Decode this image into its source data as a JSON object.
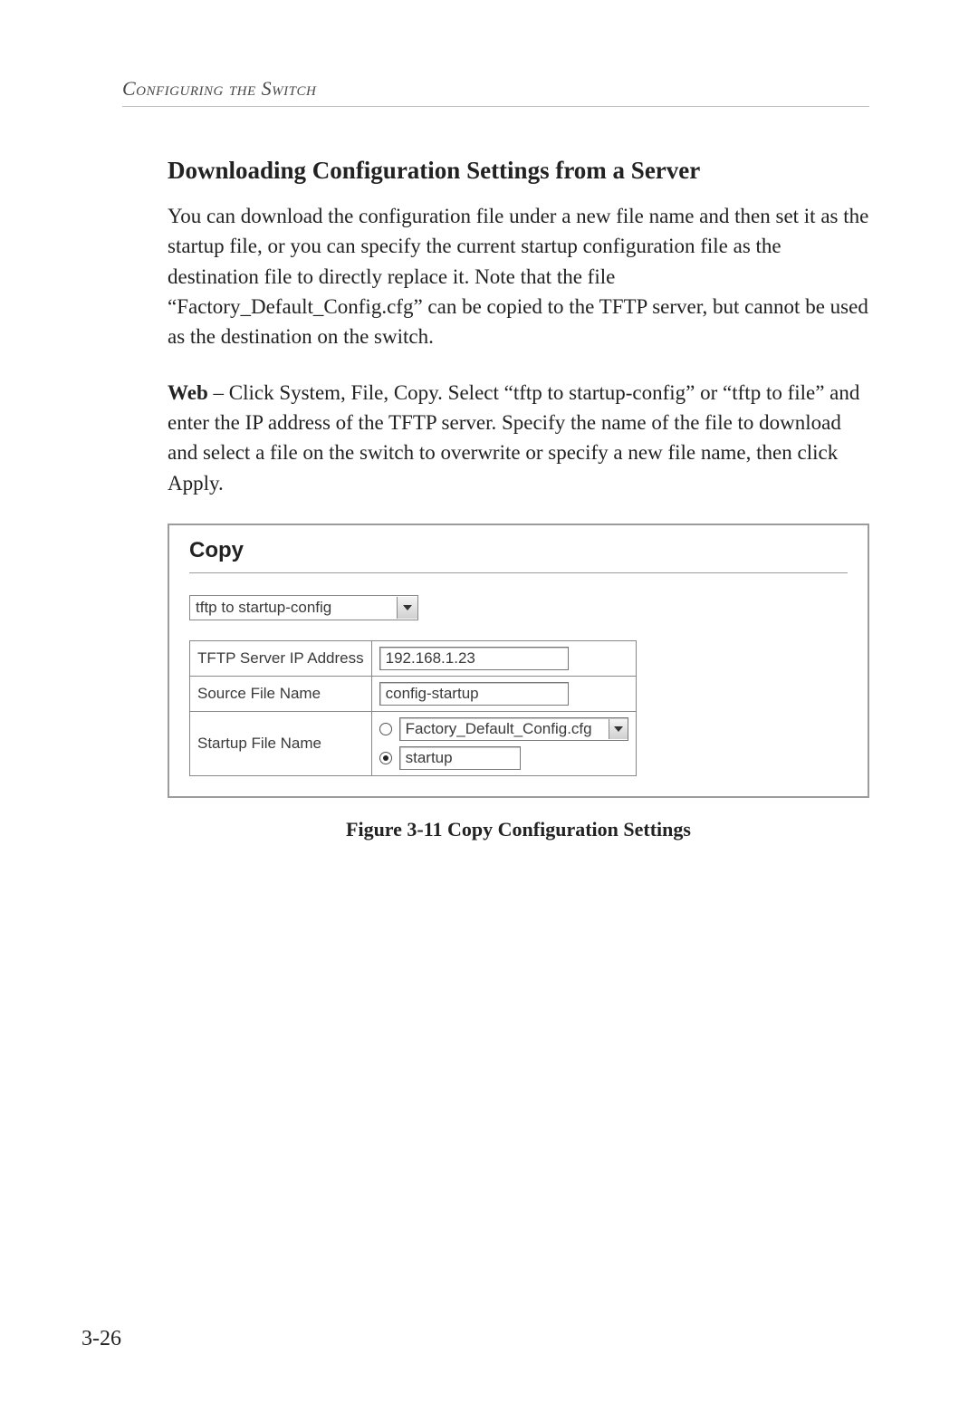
{
  "running_head": "Configuring the Switch",
  "section_title": "Downloading Configuration Settings from a Server",
  "para1": "You can download the configuration file under a new file name and then set it as the startup file, or you can specify the current startup configuration file as the destination file to directly replace it. Note that the file “Factory_Default_Config.cfg” can be copied to the TFTP server, but cannot be used as the destination on the switch.",
  "para2_lead": "Web",
  "para2_rest": " – Click System, File, Copy. Select “tftp to startup-config” or “tftp to file” and enter the IP address of the TFTP server. Specify the name of the file to download and select a file on the switch to overwrite or specify a new file name, then click Apply.",
  "screenshot": {
    "title": "Copy",
    "mode_select_value": "tftp to startup-config",
    "rows": {
      "ip_label": "TFTP Server IP Address",
      "ip_value": "192.168.1.23",
      "src_label": "Source File Name",
      "src_value": "config-startup",
      "startup_label": "Startup File Name",
      "startup_select_value": "Factory_Default_Config.cfg",
      "startup_text_value": "startup"
    }
  },
  "figure_caption": "Figure 3-11  Copy Configuration Settings",
  "page_number": "3-26"
}
